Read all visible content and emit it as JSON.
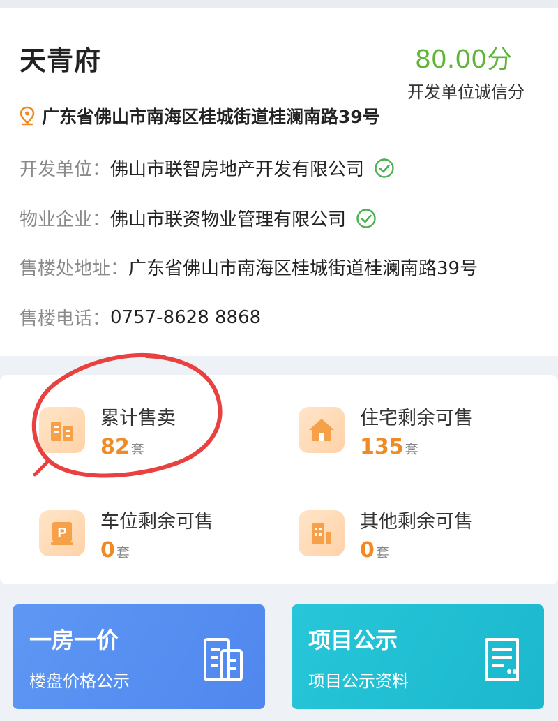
{
  "project": {
    "name": "天青府",
    "score": "80.00分",
    "score_label": "开发单位诚信分",
    "address": "广东省佛山市南海区桂城街道桂澜南路39号"
  },
  "info": {
    "developer_key": "开发单位：",
    "developer_value": "佛山市联智房地产开发有限公司",
    "property_key": "物业企业：",
    "property_value": "佛山市联资物业管理有限公司",
    "sales_office_key": "售楼处地址：",
    "sales_office_value": "广东省佛山市南海区桂城街道桂澜南路39号",
    "phone_key": "售楼电话：",
    "phone_value": "0757-8628 8868"
  },
  "stats": {
    "sold": {
      "label": "累计售卖",
      "value": "82",
      "unit": "套",
      "icon": "building-icon"
    },
    "residential": {
      "label": "住宅剩余可售",
      "value": "135",
      "unit": "套",
      "icon": "house-icon"
    },
    "parking": {
      "label": "车位剩余可售",
      "value": "0",
      "unit": "套",
      "icon": "parking-icon"
    },
    "other": {
      "label": "其他剩余可售",
      "value": "0",
      "unit": "套",
      "icon": "office-icon"
    }
  },
  "buttons": {
    "price": {
      "title": "一房一价",
      "subtitle": "楼盘价格公示",
      "color": "#5b93f2",
      "icon": "document-list-icon"
    },
    "publicity": {
      "title": "项目公示",
      "subtitle": "项目公示资料",
      "color": "#22bfd3",
      "icon": "notice-icon"
    }
  },
  "colors": {
    "score": "#5fb53a",
    "accent": "#f08a24",
    "check": "#4caf50",
    "annotation": "#e8413f"
  }
}
